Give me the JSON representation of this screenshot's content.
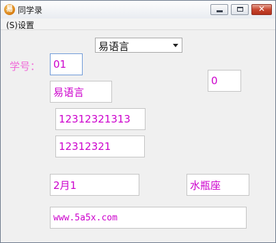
{
  "window": {
    "title": "同学录"
  },
  "menu": {
    "items": [
      "(S)设置"
    ]
  },
  "form": {
    "dropdown_value": "易语言",
    "student_id_label": "学号：",
    "student_id": "01",
    "counter": "0",
    "name": "易语言",
    "phone1": "12312321313",
    "phone2": "12312321",
    "birthday": "2月1",
    "zodiac": "水瓶座",
    "website": "www.5a5x.com"
  },
  "colors": {
    "text_value": "#cc00cc",
    "label": "#f06ad8",
    "background": "#f0f0f0"
  }
}
